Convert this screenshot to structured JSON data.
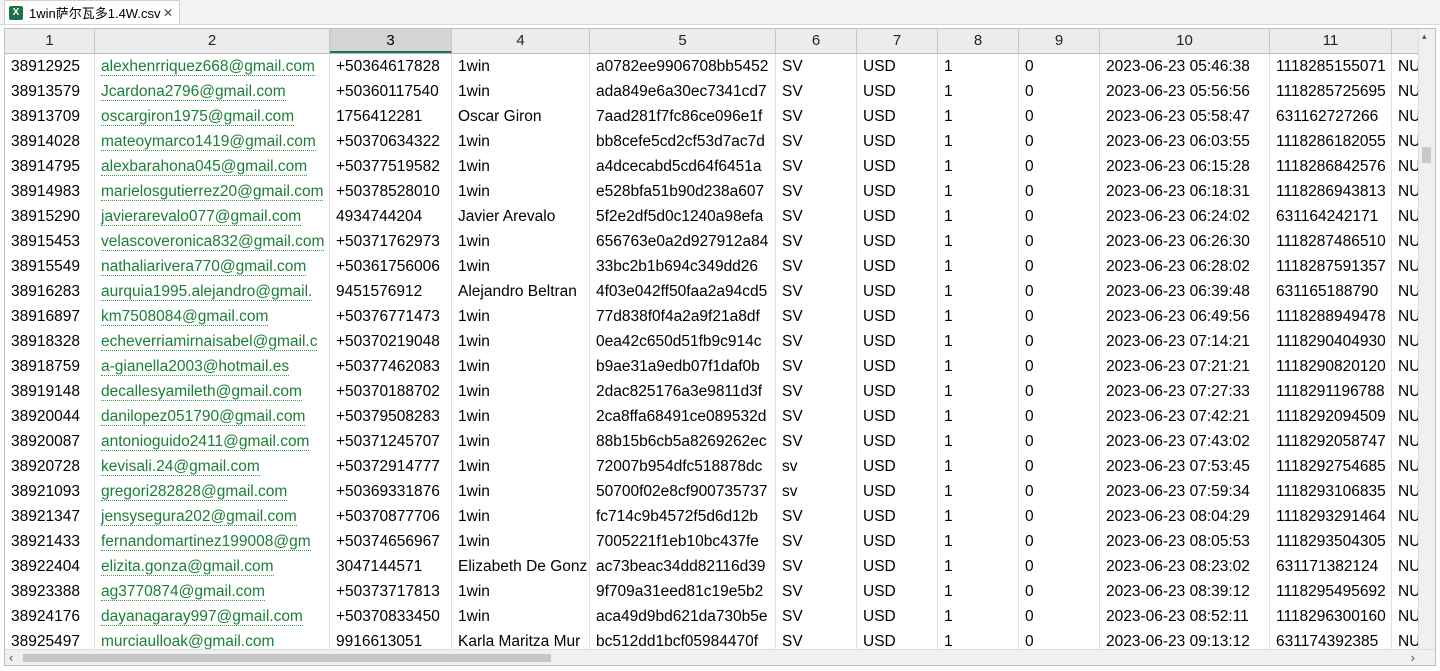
{
  "tab": {
    "title": "1win萨尔瓦多1.4W.csv",
    "icon": "excel-file-icon",
    "icon_glyph": "X",
    "close_glyph": "✕"
  },
  "columns": [
    "1",
    "2",
    "3",
    "4",
    "5",
    "6",
    "7",
    "8",
    "9",
    "10",
    "11"
  ],
  "selected_column": "3",
  "rows": [
    [
      "38912925",
      "alexhenrriquez668@gmail.com",
      "+50364617828",
      "1win",
      "a0782ee9906708bb5452",
      "SV",
      "USD",
      "1",
      "0",
      "2023-06-23 05:46:38",
      "1118285155071",
      "NU"
    ],
    [
      "38913579",
      "Jcardona2796@gmail.com",
      "+50360117540",
      "1win",
      "ada849e6a30ec7341cd7",
      "SV",
      "USD",
      "1",
      "0",
      "2023-06-23 05:56:56",
      "1118285725695",
      "NU"
    ],
    [
      "38913709",
      "oscargiron1975@gmail.com",
      "1756412281",
      "Oscar Giron",
      "7aad281f7fc86ce096e1f",
      "SV",
      "USD",
      "1",
      "0",
      "2023-06-23 05:58:47",
      "631162727266",
      "NU"
    ],
    [
      "38914028",
      "mateoymarco1419@gmail.com",
      "+50370634322",
      "1win",
      "bb8cefe5cd2cf53d7ac7d",
      "SV",
      "USD",
      "1",
      "0",
      "2023-06-23 06:03:55",
      "1118286182055",
      "NU"
    ],
    [
      "38914795",
      "alexbarahona045@gmail.com",
      "+50377519582",
      "1win",
      "a4dcecabd5cd64f6451a",
      "SV",
      "USD",
      "1",
      "0",
      "2023-06-23 06:15:28",
      "1118286842576",
      "NU"
    ],
    [
      "38914983",
      "marielosgutierrez20@gmail.com",
      "+50378528010",
      "1win",
      "e528bfa51b90d238a607",
      "SV",
      "USD",
      "1",
      "0",
      "2023-06-23 06:18:31",
      "1118286943813",
      "NU"
    ],
    [
      "38915290",
      "javierarevalo077@gmail.com",
      "4934744204",
      "Javier Arevalo",
      "5f2e2df5d0c1240a98efa",
      "SV",
      "USD",
      "1",
      "0",
      "2023-06-23 06:24:02",
      "631164242171",
      "NU"
    ],
    [
      "38915453",
      "velascoveronica832@gmail.com",
      "+50371762973",
      "1win",
      "656763e0a2d927912a84",
      "SV",
      "USD",
      "1",
      "0",
      "2023-06-23 06:26:30",
      "1118287486510",
      "NU"
    ],
    [
      "38915549",
      "nathaliarivera770@gmail.com",
      "+50361756006",
      "1win",
      "33bc2b1b694c349dd26",
      "SV",
      "USD",
      "1",
      "0",
      "2023-06-23 06:28:02",
      "1118287591357",
      "NU"
    ],
    [
      "38916283",
      "aurquia1995.alejandro@gmail.",
      "9451576912",
      "Alejandro Beltran",
      "4f03e042ff50faa2a94cd5",
      "SV",
      "USD",
      "1",
      "0",
      "2023-06-23 06:39:48",
      "631165188790",
      "NU"
    ],
    [
      "38916897",
      "km7508084@gmail.com",
      "+50376771473",
      "1win",
      "77d838f0f4a2a9f21a8df",
      "SV",
      "USD",
      "1",
      "0",
      "2023-06-23 06:49:56",
      "1118288949478",
      "NU"
    ],
    [
      "38918328",
      "echeverriamirnaisabel@gmail.c",
      "+50370219048",
      "1win",
      "0ea42c650d51fb9c914c",
      "SV",
      "USD",
      "1",
      "0",
      "2023-06-23 07:14:21",
      "1118290404930",
      "NU"
    ],
    [
      "38918759",
      "a-gianella2003@hotmail.es",
      "+50377462083",
      "1win",
      "b9ae31a9edb07f1daf0b",
      "SV",
      "USD",
      "1",
      "0",
      "2023-06-23 07:21:21",
      "1118290820120",
      "NU"
    ],
    [
      "38919148",
      "decallesyamileth@gmail.com",
      "+50370188702",
      "1win",
      "2dac825176a3e9811d3f",
      "SV",
      "USD",
      "1",
      "0",
      "2023-06-23 07:27:33",
      "1118291196788",
      "NU"
    ],
    [
      "38920044",
      "danilopez051790@gmail.com",
      "+50379508283",
      "1win",
      "2ca8ffa68491ce089532d",
      "SV",
      "USD",
      "1",
      "0",
      "2023-06-23 07:42:21",
      "1118292094509",
      "NU"
    ],
    [
      "38920087",
      "antonioguido2411@gmail.com",
      "+50371245707",
      "1win",
      "88b15b6cb5a8269262ec",
      "SV",
      "USD",
      "1",
      "0",
      "2023-06-23 07:43:02",
      "1118292058747",
      "NU"
    ],
    [
      "38920728",
      "kevisali.24@gmail.com",
      "+50372914777",
      "1win",
      "72007b954dfc518878dc",
      "sv",
      "USD",
      "1",
      "0",
      "2023-06-23 07:53:45",
      "1118292754685",
      "NU"
    ],
    [
      "38921093",
      "gregori282828@gmail.com",
      "+50369331876",
      "1win",
      "50700f02e8cf900735737",
      "sv",
      "USD",
      "1",
      "0",
      "2023-06-23 07:59:34",
      "1118293106835",
      "NU"
    ],
    [
      "38921347",
      "jensysegura202@gmail.com",
      "+50370877706",
      "1win",
      "fc714c9b4572f5d6d12b",
      "SV",
      "USD",
      "1",
      "0",
      "2023-06-23 08:04:29",
      "1118293291464",
      "NU"
    ],
    [
      "38921433",
      "fernandomartinez199008@gm",
      "+50374656967",
      "1win",
      "7005221f1eb10bc437fe",
      "SV",
      "USD",
      "1",
      "0",
      "2023-06-23 08:05:53",
      "1118293504305",
      "NU"
    ],
    [
      "38922404",
      "elizita.gonza@gmail.com",
      "3047144571",
      "Elizabeth De Gonz",
      "ac73beac34dd82116d39",
      "SV",
      "USD",
      "1",
      "0",
      "2023-06-23 08:23:02",
      "631171382124",
      "NU"
    ],
    [
      "38923388",
      "ag3770874@gmail.com",
      "+50373717813",
      "1win",
      "9f709a31eed81c19e5b2",
      "SV",
      "USD",
      "1",
      "0",
      "2023-06-23 08:39:12",
      "1118295495692",
      "NU"
    ],
    [
      "38924176",
      "dayanagaray997@gmail.com",
      "+50370833450",
      "1win",
      "aca49d9bd621da730b5e",
      "SV",
      "USD",
      "1",
      "0",
      "2023-06-23 08:52:11",
      "1118296300160",
      "NU"
    ],
    [
      "38925497",
      "murciaulloak@gmail.com",
      "9916613051",
      "Karla Maritza Mur",
      "bc512dd1bcf05984470f",
      "SV",
      "USD",
      "1",
      "0",
      "2023-06-23 09:13:12",
      "631174392385",
      "NU"
    ]
  ],
  "scroll": {
    "left_glyph": "‹",
    "right_glyph": "›",
    "up_glyph": "▴",
    "down_glyph": "▾"
  }
}
